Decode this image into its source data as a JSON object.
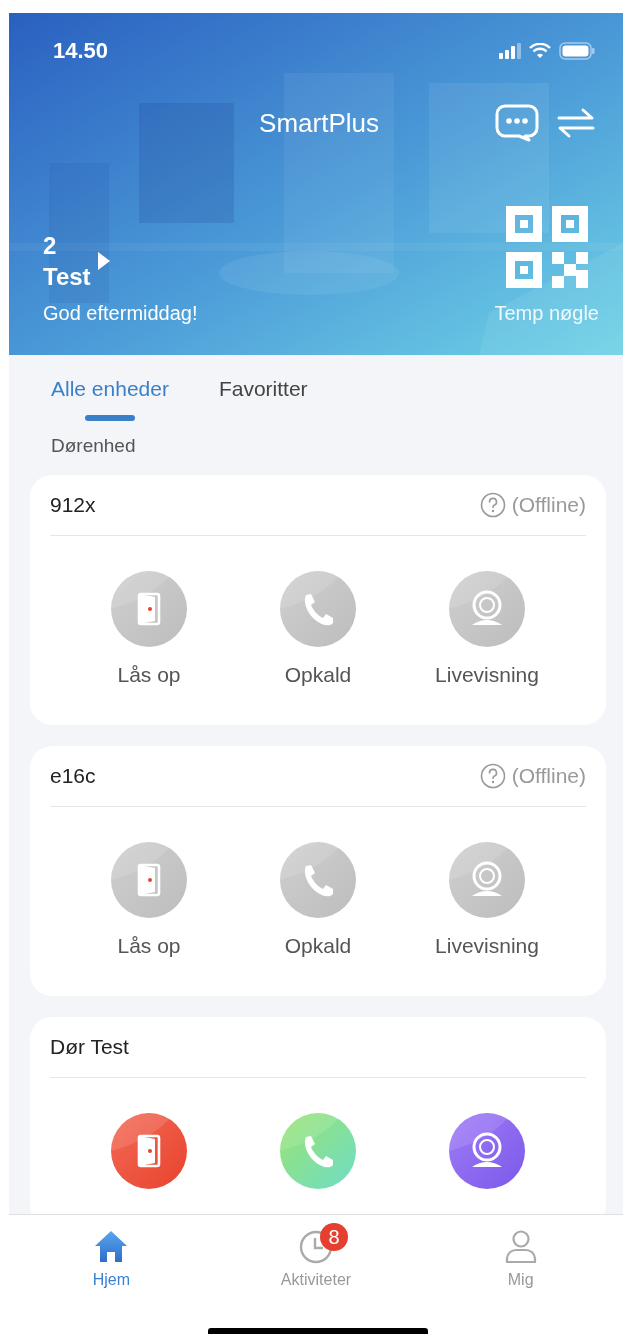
{
  "status_bar": {
    "time": "14.50"
  },
  "header": {
    "title": "SmartPlus",
    "home_number": "2",
    "home_name": "Test",
    "greeting": "God eftermiddag!",
    "temp_key_label": "Temp nøgle"
  },
  "tabs": [
    {
      "label": "Alle enheder",
      "selected": true
    },
    {
      "label": "Favoritter",
      "selected": false
    }
  ],
  "section_title": "Dørenhed",
  "devices": [
    {
      "name": "912x",
      "offline": true,
      "status": "(Offline)",
      "actions": [
        {
          "kind": "unlock",
          "label": "Lås op"
        },
        {
          "kind": "call",
          "label": "Opkald"
        },
        {
          "kind": "live",
          "label": "Livevisning"
        }
      ]
    },
    {
      "name": "e16c",
      "offline": true,
      "status": "(Offline)",
      "actions": [
        {
          "kind": "unlock",
          "label": "Lås op"
        },
        {
          "kind": "call",
          "label": "Opkald"
        },
        {
          "kind": "live",
          "label": "Livevisning"
        }
      ]
    },
    {
      "name": "Dør Test",
      "offline": false,
      "actions": [
        {
          "kind": "unlock"
        },
        {
          "kind": "call"
        },
        {
          "kind": "live"
        }
      ]
    }
  ],
  "nav": [
    {
      "kind": "home",
      "label": "Hjem",
      "selected": true
    },
    {
      "kind": "activity",
      "label": "Aktiviteter",
      "selected": false,
      "badge": "8"
    },
    {
      "kind": "me",
      "label": "Mig",
      "selected": false
    }
  ]
}
